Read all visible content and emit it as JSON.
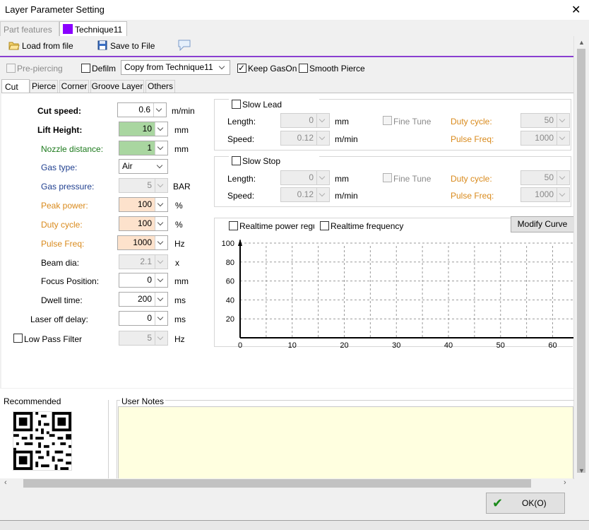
{
  "window": {
    "title": "Layer Parameter Setting"
  },
  "doc_tabs": [
    {
      "label": "Part features"
    },
    {
      "label": "Technique11",
      "color": "#8a00ff"
    }
  ],
  "toolbar": {
    "load_label": "Load from file",
    "save_label": "Save to File"
  },
  "options": {
    "pre_piercing": "Pre-piercing",
    "defilm": "Defilm",
    "copy_from": "Copy from Technique11",
    "keep_gason": "Keep GasOn",
    "smooth_pierce": "Smooth Pierce"
  },
  "sub_tabs": [
    {
      "label": "Cut"
    },
    {
      "label": "Pierce"
    },
    {
      "label": "Corner"
    },
    {
      "label": "Groove Layer"
    },
    {
      "label": "Others"
    }
  ],
  "params": {
    "cut_speed": {
      "label": "Cut speed:",
      "value": "0.6",
      "unit": "m/min"
    },
    "lift_height": {
      "label": "Lift Height:",
      "value": "10",
      "unit": "mm"
    },
    "nozzle_distance": {
      "label": "Nozzle distance:",
      "value": "1",
      "unit": "mm"
    },
    "gas_type": {
      "label": "Gas type:",
      "value": "Air"
    },
    "gas_pressure": {
      "label": "Gas pressure:",
      "value": "5",
      "unit": "BAR"
    },
    "peak_power": {
      "label": "Peak power:",
      "value": "100",
      "unit": "%"
    },
    "duty_cycle": {
      "label": "Duty cycle:",
      "value": "100",
      "unit": "%"
    },
    "pulse_freq": {
      "label": "Pulse Freq:",
      "value": "1000",
      "unit": "Hz"
    },
    "beam_dia": {
      "label": "Beam dia:",
      "value": "2.1",
      "unit": "x"
    },
    "focus_position": {
      "label": "Focus Position:",
      "value": "0",
      "unit": "mm"
    },
    "dwell_time": {
      "label": "Dwell time:",
      "value": "200",
      "unit": "ms"
    },
    "laser_off_delay": {
      "label": "Laser off delay:",
      "value": "0",
      "unit": "ms"
    },
    "low_pass_filter": {
      "label": "Low Pass Filter",
      "value": "5",
      "unit": "Hz"
    }
  },
  "slow_lead": {
    "title": "Slow Lead",
    "length_label": "Length:",
    "length_value": "0",
    "length_unit": "mm",
    "speed_label": "Speed:",
    "speed_value": "0.12",
    "speed_unit": "m/min",
    "fine_tune": "Fine Tune",
    "duty_label": "Duty cycle:",
    "duty_value": "50",
    "freq_label": "Pulse Freq:",
    "freq_value": "1000"
  },
  "slow_stop": {
    "title": "Slow Stop",
    "length_label": "Length:",
    "length_value": "0",
    "length_unit": "mm",
    "speed_label": "Speed:",
    "speed_value": "0.12",
    "speed_unit": "m/min",
    "fine_tune": "Fine Tune",
    "duty_label": "Duty cycle:",
    "duty_value": "50",
    "freq_label": "Pulse Freq:",
    "freq_value": "1000"
  },
  "curve": {
    "realtime_power": "Realtime power regula",
    "realtime_freq": "Realtime frequency re",
    "modify_button": "Modify Curve"
  },
  "chart_data": {
    "type": "line",
    "x_ticks": [
      "0",
      "10",
      "20",
      "30",
      "40",
      "50",
      "60"
    ],
    "y_ticks": [
      "20",
      "40",
      "60",
      "80",
      "100"
    ],
    "xlim": [
      0,
      64
    ],
    "ylim": [
      0,
      100
    ],
    "grid": true,
    "series": []
  },
  "bottom": {
    "recommended": "Recommended",
    "user_notes": "User Notes",
    "notes_text": ""
  },
  "footer": {
    "ok_label": "OK(O)"
  }
}
